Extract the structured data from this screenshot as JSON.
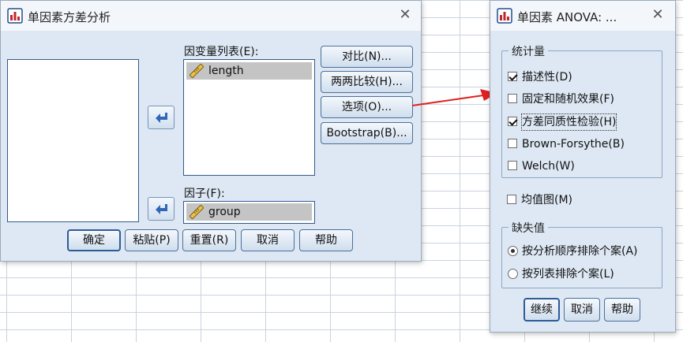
{
  "main_dialog": {
    "title": "单因素方差分析",
    "dependent_list_label": "因变量列表(E):",
    "dependent_items": [
      {
        "label": "length",
        "icon": "ruler-icon"
      }
    ],
    "factor_label": "因子(F):",
    "factor_item": {
      "label": "group",
      "icon": "ruler-icon"
    },
    "side_buttons": {
      "contrast": "对比(N)...",
      "post_hoc": "两两比较(H)...",
      "options": "选项(O)...",
      "bootstrap": "Bootstrap(B)..."
    },
    "bottom_buttons": {
      "ok": "确定",
      "paste": "粘贴(P)",
      "reset": "重置(R)",
      "cancel": "取消",
      "help": "帮助"
    }
  },
  "options_dialog": {
    "title": "单因素 ANOVA: ...",
    "statistics_group": "统计量",
    "statistics": [
      {
        "label": "描述性(D)",
        "checked": true
      },
      {
        "label": "固定和随机效果(F)",
        "checked": false
      },
      {
        "label": "方差同质性检验(H)",
        "checked": true
      },
      {
        "label": "Brown-Forsythe(B)",
        "checked": false
      },
      {
        "label": "Welch(W)",
        "checked": false
      }
    ],
    "means_plot": {
      "label": "均值图(M)",
      "checked": false
    },
    "missing_group": "缺失值",
    "missing_options": [
      {
        "label": "按分析顺序排除个案(A)",
        "selected": true
      },
      {
        "label": "按列表排除个案(L)",
        "selected": false
      }
    ],
    "buttons": {
      "continue": "继续",
      "cancel": "取消",
      "help": "帮助"
    }
  },
  "colors": {
    "dialog_bg": "#dde8f4",
    "selected_item_bg": "#c4c4c4",
    "annotation_arrow": "#e02020",
    "button_border": "#4d6f99"
  }
}
